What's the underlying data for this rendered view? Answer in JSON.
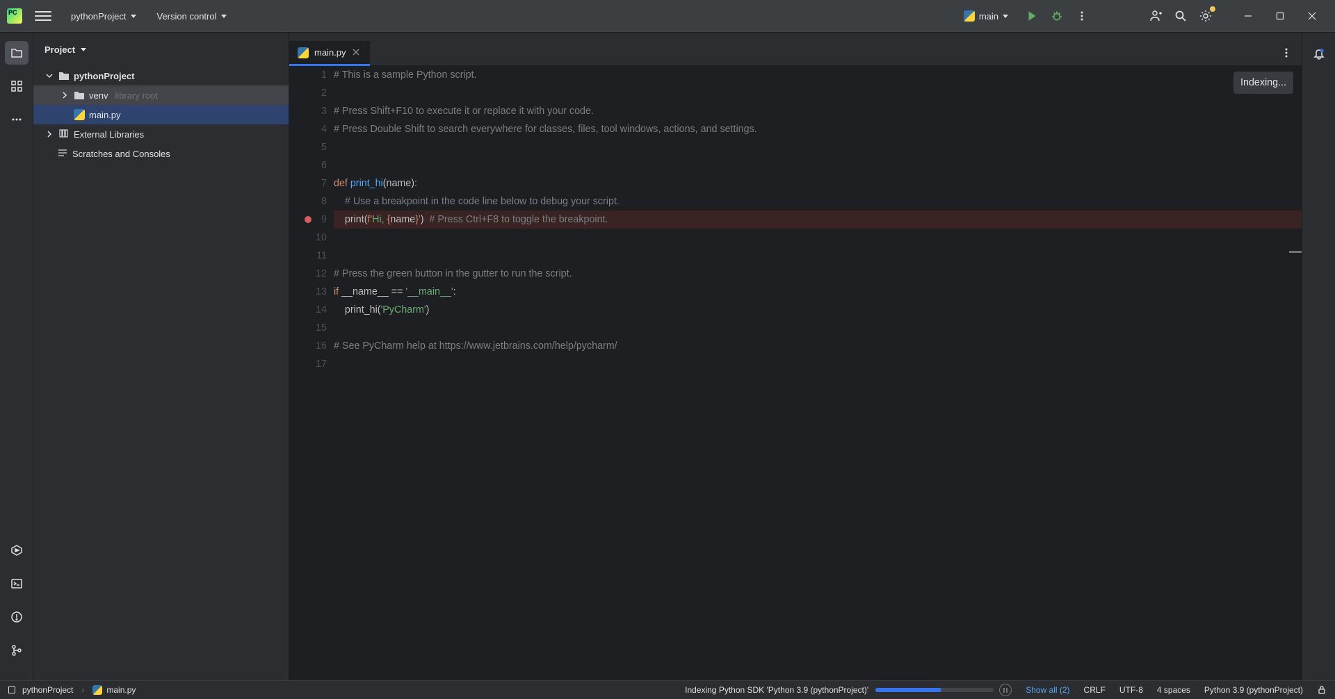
{
  "titlebar": {
    "project_name": "pythonProject",
    "vcs_label": "Version control",
    "run_config": "main"
  },
  "sidebar": {
    "header": "Project",
    "tree": {
      "root": "pythonProject",
      "venv": "venv",
      "venv_hint": "library root",
      "main_file": "main.py",
      "external_libs": "External Libraries",
      "scratches": "Scratches and Consoles"
    }
  },
  "editor": {
    "tab_name": "main.py",
    "indexing_label": "Indexing...",
    "lines": [
      {
        "n": 1,
        "segs": [
          {
            "c": "c-comment",
            "t": "# This is a sample Python script."
          }
        ]
      },
      {
        "n": 2,
        "segs": []
      },
      {
        "n": 3,
        "segs": [
          {
            "c": "c-comment",
            "t": "# Press Shift+F10 to execute it or replace it with your code."
          }
        ]
      },
      {
        "n": 4,
        "segs": [
          {
            "c": "c-comment",
            "t": "# Press Double Shift to search everywhere for classes, files, tool windows, actions, and settings."
          }
        ]
      },
      {
        "n": 5,
        "segs": []
      },
      {
        "n": 6,
        "segs": []
      },
      {
        "n": 7,
        "segs": [
          {
            "c": "c-keyword",
            "t": "def "
          },
          {
            "c": "c-func",
            "t": "print_hi"
          },
          {
            "c": "c-default",
            "t": "(name):"
          }
        ]
      },
      {
        "n": 8,
        "segs": [
          {
            "c": "c-default",
            "t": "    "
          },
          {
            "c": "c-comment",
            "t": "# Use a breakpoint in the code line below to debug your script."
          }
        ]
      },
      {
        "n": 9,
        "bp": true,
        "segs": [
          {
            "c": "c-default",
            "t": "    print("
          },
          {
            "c": "c-fstr",
            "t": "f"
          },
          {
            "c": "c-string",
            "t": "'Hi, "
          },
          {
            "c": "c-keyword",
            "t": "{"
          },
          {
            "c": "c-default",
            "t": "name"
          },
          {
            "c": "c-keyword",
            "t": "}"
          },
          {
            "c": "c-string",
            "t": "'"
          },
          {
            "c": "c-default",
            "t": ")  "
          },
          {
            "c": "c-comment",
            "t": "# Press Ctrl+F8 to toggle the breakpoint."
          }
        ]
      },
      {
        "n": 10,
        "segs": []
      },
      {
        "n": 11,
        "segs": []
      },
      {
        "n": 12,
        "segs": [
          {
            "c": "c-comment",
            "t": "# Press the green button in the gutter to run the script."
          }
        ]
      },
      {
        "n": 13,
        "segs": [
          {
            "c": "c-keyword",
            "t": "if "
          },
          {
            "c": "c-default",
            "t": "__name__ == "
          },
          {
            "c": "c-string",
            "t": "'__main__'"
          },
          {
            "c": "c-default",
            "t": ":"
          }
        ]
      },
      {
        "n": 14,
        "segs": [
          {
            "c": "c-default",
            "t": "    print_hi("
          },
          {
            "c": "c-string",
            "t": "'PyCharm'"
          },
          {
            "c": "c-default",
            "t": ")"
          }
        ]
      },
      {
        "n": 15,
        "segs": []
      },
      {
        "n": 16,
        "segs": [
          {
            "c": "c-comment",
            "t": "# See PyCharm help at https://www.jetbrains.com/help/pycharm/"
          }
        ]
      },
      {
        "n": 17,
        "segs": []
      }
    ]
  },
  "statusbar": {
    "crumb_project": "pythonProject",
    "crumb_file": "main.py",
    "indexing_msg": "Indexing Python SDK 'Python 3.9 (pythonProject)'",
    "show_all": "Show all (2)",
    "line_sep": "CRLF",
    "encoding": "UTF-8",
    "indent": "4 spaces",
    "interpreter": "Python 3.9 (pythonProject)"
  }
}
